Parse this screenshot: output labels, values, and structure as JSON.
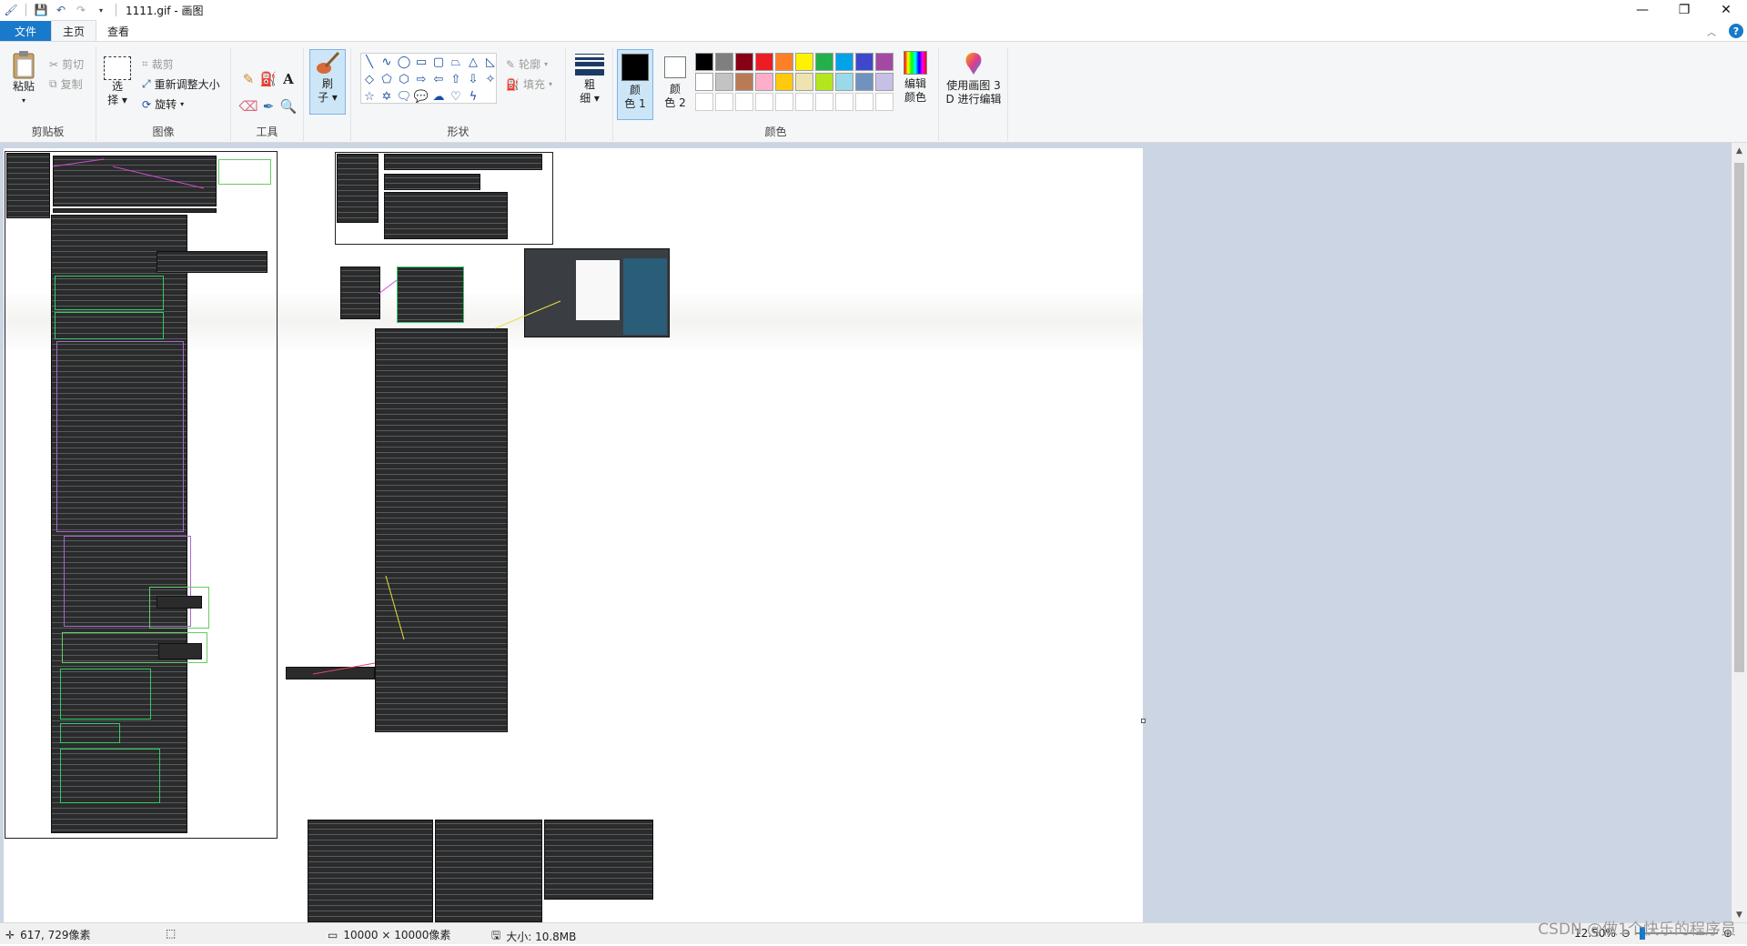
{
  "window": {
    "title": "1111.gif - 画图",
    "controls": {
      "minimize": "—",
      "restore": "❐",
      "close": "✕"
    }
  },
  "tabs": [
    {
      "label": "文件"
    },
    {
      "label": "主页"
    },
    {
      "label": "查看"
    }
  ],
  "ribbon": {
    "clipboard": {
      "paste": "粘贴",
      "cut": "剪切",
      "copy": "复制",
      "group": "剪贴板"
    },
    "image": {
      "select": "选",
      "select2": "择",
      "crop": "裁剪",
      "resize": "重新调整大小",
      "rotate": "旋转",
      "group": "图像"
    },
    "tools": {
      "group": "工具"
    },
    "brushes": {
      "label1": "刷",
      "label2": "子"
    },
    "shapes": {
      "outline": "轮廓",
      "fill": "填充",
      "group": "形状"
    },
    "size": {
      "label1": "粗",
      "label2": "细"
    },
    "colors": {
      "color1_a": "颜",
      "color1_b": "色 1",
      "color2_a": "颜",
      "color2_b": "色 2",
      "edit_a": "编辑",
      "edit_b": "颜色",
      "group": "颜色",
      "color1_value": "#000000",
      "color2_value": "#ffffff",
      "palette": [
        "#000000",
        "#7f7f7f",
        "#880015",
        "#ed1c24",
        "#ff7f27",
        "#fff200",
        "#22b14c",
        "#00a2e8",
        "#3f48cc",
        "#a349a4",
        "#ffffff",
        "#c3c3c3",
        "#b97a57",
        "#ffaec9",
        "#ffc90e",
        "#efe4b0",
        "#b5e61d",
        "#99d9ea",
        "#7092be",
        "#c8bfe7"
      ]
    },
    "paint3d": {
      "label1": "使用画图 3",
      "label2": "D 进行编辑"
    }
  },
  "statusbar": {
    "cursor": "617, 729像素",
    "canvas_size": "10000 × 10000像素",
    "file_size": "大小: 10.8MB",
    "zoom": "12.50%"
  },
  "watermark": "CSDN @做1个快乐的程序员"
}
